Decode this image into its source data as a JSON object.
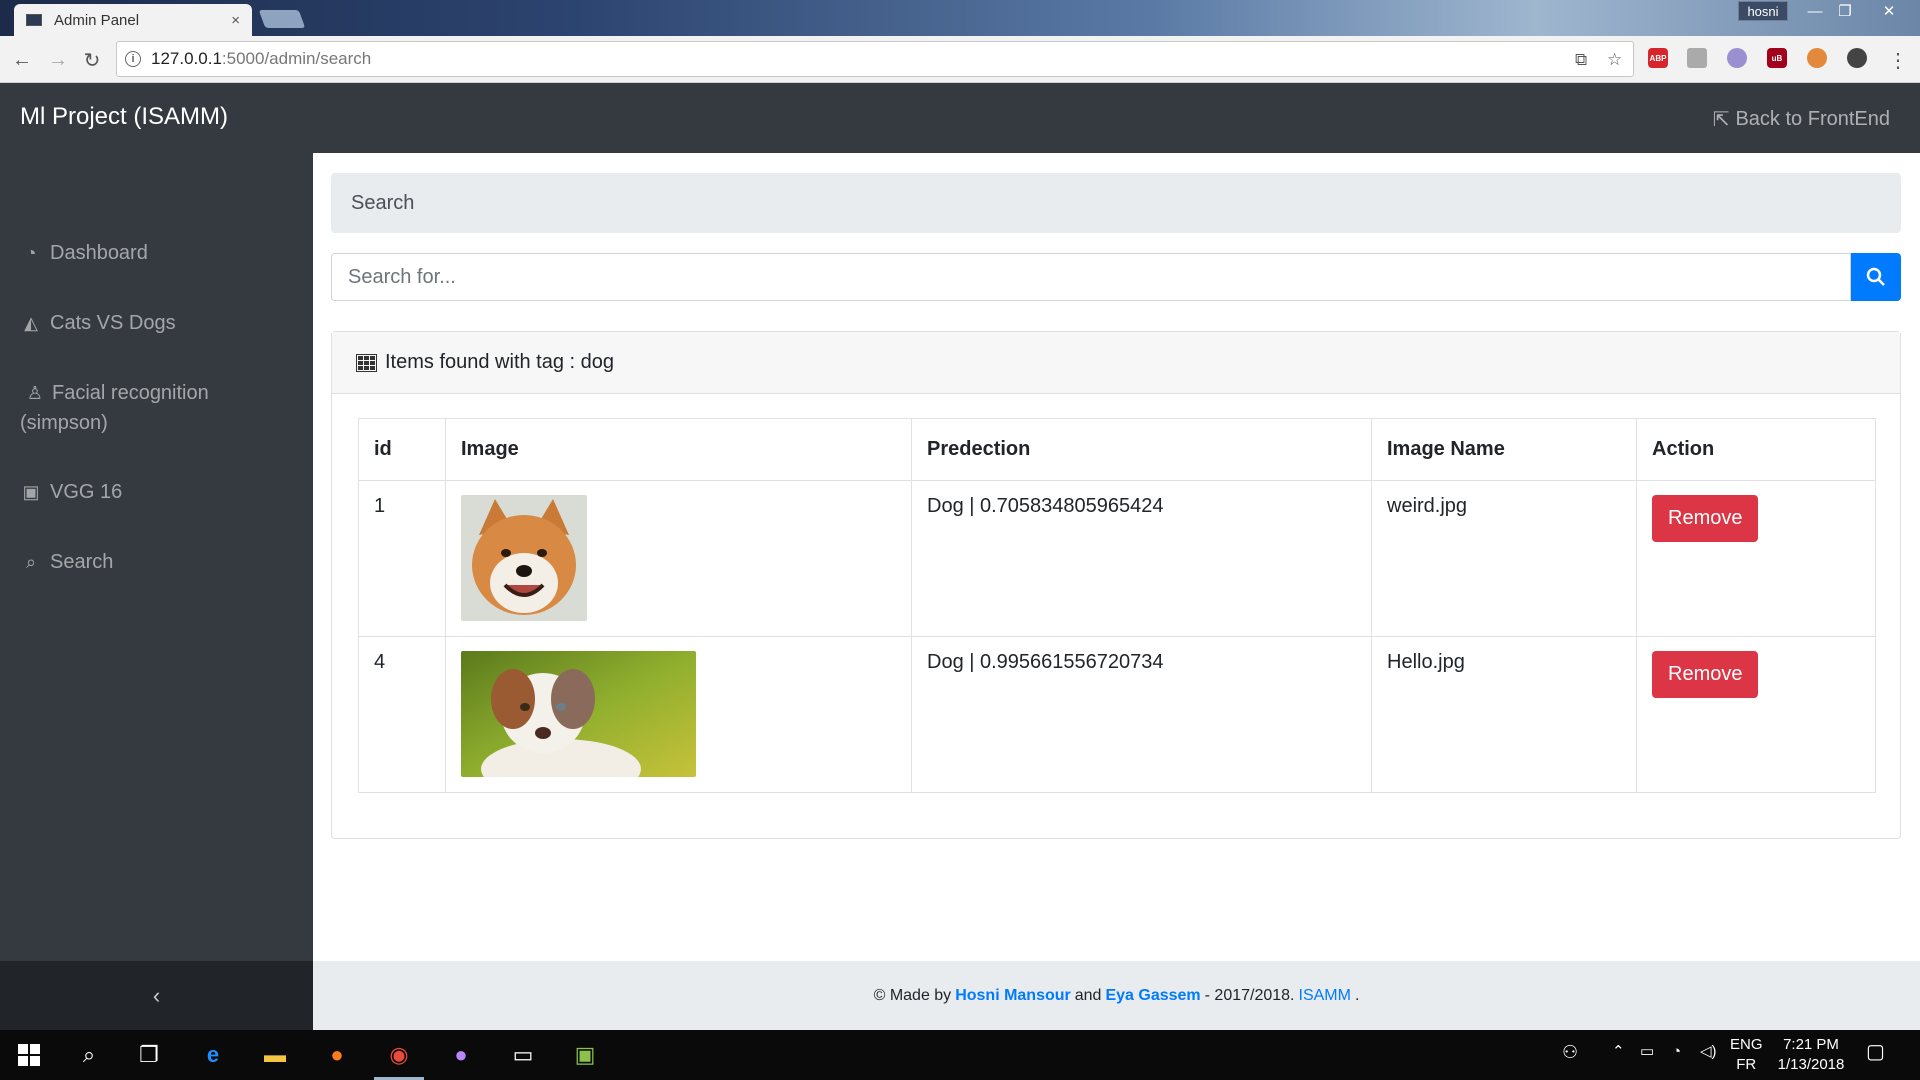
{
  "browser": {
    "tab_title": "Admin Panel",
    "tab_close": "×",
    "user": "hosni",
    "url_host": "127.0.0.1",
    "url_path": ":5000/admin/search",
    "win_min": "—",
    "win_restore": "❐",
    "win_close": "✕"
  },
  "app": {
    "brand": "Ml Project (ISAMM)",
    "back_link": "Back to FrontEnd"
  },
  "sidebar": {
    "items": [
      {
        "label": "Dashboard",
        "icon": "dashboard-icon"
      },
      {
        "label": "Cats VS Dogs",
        "icon": "area-chart-icon"
      },
      {
        "label": "Facial recognition (simpson)",
        "icon": "male-icon"
      },
      {
        "label": "VGG 16",
        "icon": "image-icon"
      },
      {
        "label": "Search",
        "icon": "search-icon"
      }
    ],
    "toggle": "‹"
  },
  "main": {
    "breadcrumb": "Search",
    "search_placeholder": "Search for...",
    "card_title": "Items found with tag : dog",
    "columns": [
      "id",
      "Image",
      "Predection",
      "Image Name",
      "Action"
    ],
    "rows": [
      {
        "id": "1",
        "prediction": "Dog | 0.705834805965424",
        "image_name": "weird.jpg",
        "action": "Remove"
      },
      {
        "id": "4",
        "prediction": "Dog | 0.995661556720734",
        "image_name": "Hello.jpg",
        "action": "Remove"
      }
    ]
  },
  "footer": {
    "prefix": "© Made by",
    "author1": "Hosni Mansour",
    "and": "and",
    "author2": "Eya Gassem",
    "years": "- 2017/2018.",
    "org": "ISAMM",
    "end": "."
  },
  "taskbar": {
    "lang": "ENG",
    "layout": "FR",
    "time": "7:21 PM",
    "date": "1/13/2018"
  },
  "colors": {
    "sidebar": "#343a40",
    "primary": "#007bff",
    "danger": "#dc3545"
  }
}
